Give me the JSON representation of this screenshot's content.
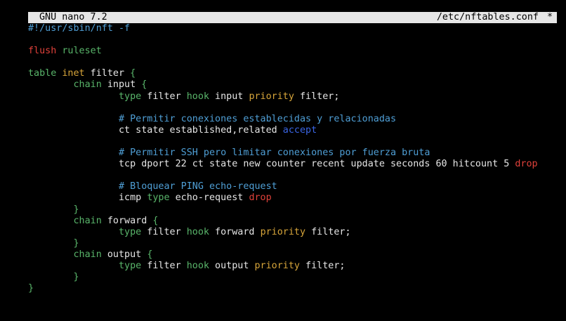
{
  "colors": {
    "background": "#000000",
    "foreground": "#e6e6e6",
    "title_bg": "#e6e6e6",
    "title_fg": "#000000",
    "red": "#e0413a",
    "green": "#59b56a",
    "yellow": "#d7a53a",
    "blue": "#3a66e6",
    "comment": "#4f9fd6"
  },
  "titlebar": {
    "app": "GNU nano 7.2",
    "file": "/etc/nftables.conf",
    "modified": "*"
  },
  "lines": [
    [
      {
        "t": "#!/usr/sbin/nft -f",
        "c": "comment"
      }
    ],
    [],
    [
      {
        "t": "flush",
        "c": "red"
      },
      {
        "t": " "
      },
      {
        "t": "ruleset",
        "c": "green"
      }
    ],
    [],
    [
      {
        "t": "table",
        "c": "green"
      },
      {
        "t": " "
      },
      {
        "t": "inet",
        "c": "yellow"
      },
      {
        "t": " filter "
      },
      {
        "t": "{",
        "c": "green"
      }
    ],
    [
      {
        "t": "        "
      },
      {
        "t": "chain",
        "c": "green"
      },
      {
        "t": " input "
      },
      {
        "t": "{",
        "c": "green"
      }
    ],
    [
      {
        "t": "                "
      },
      {
        "t": "type",
        "c": "green"
      },
      {
        "t": " filter "
      },
      {
        "t": "hook",
        "c": "green"
      },
      {
        "t": " input "
      },
      {
        "t": "priority",
        "c": "yellow"
      },
      {
        "t": " filter;"
      }
    ],
    [],
    [
      {
        "t": "                "
      },
      {
        "t": "# Permitir conexiones establecidas y relacionadas",
        "c": "comment"
      }
    ],
    [
      {
        "t": "                ct state established,related "
      },
      {
        "t": "accept",
        "c": "blue"
      }
    ],
    [],
    [
      {
        "t": "                "
      },
      {
        "t": "# Permitir SSH pero limitar conexiones por fuerza bruta",
        "c": "comment"
      }
    ],
    [
      {
        "t": "                tcp dport 22 ct state new counter recent update seconds 60 hitcount 5 "
      },
      {
        "t": "drop",
        "c": "red"
      }
    ],
    [],
    [
      {
        "t": "                "
      },
      {
        "t": "# Bloquear PING echo-request",
        "c": "comment"
      }
    ],
    [
      {
        "t": "                icmp "
      },
      {
        "t": "type",
        "c": "green"
      },
      {
        "t": " echo-request "
      },
      {
        "t": "drop",
        "c": "red"
      }
    ],
    [
      {
        "t": "        "
      },
      {
        "t": "}",
        "c": "green"
      }
    ],
    [
      {
        "t": "        "
      },
      {
        "t": "chain",
        "c": "green"
      },
      {
        "t": " forward "
      },
      {
        "t": "{",
        "c": "green"
      }
    ],
    [
      {
        "t": "                "
      },
      {
        "t": "type",
        "c": "green"
      },
      {
        "t": " filter "
      },
      {
        "t": "hook",
        "c": "green"
      },
      {
        "t": " forward "
      },
      {
        "t": "priority",
        "c": "yellow"
      },
      {
        "t": " filter;"
      }
    ],
    [
      {
        "t": "        "
      },
      {
        "t": "}",
        "c": "green"
      }
    ],
    [
      {
        "t": "        "
      },
      {
        "t": "chain",
        "c": "green"
      },
      {
        "t": " output "
      },
      {
        "t": "{",
        "c": "green"
      }
    ],
    [
      {
        "t": "                "
      },
      {
        "t": "type",
        "c": "green"
      },
      {
        "t": " filter "
      },
      {
        "t": "hook",
        "c": "green"
      },
      {
        "t": " output "
      },
      {
        "t": "priority",
        "c": "yellow"
      },
      {
        "t": " filter;"
      }
    ],
    [
      {
        "t": "        "
      },
      {
        "t": "}",
        "c": "green"
      }
    ],
    [
      {
        "t": "}",
        "c": "green"
      }
    ]
  ]
}
